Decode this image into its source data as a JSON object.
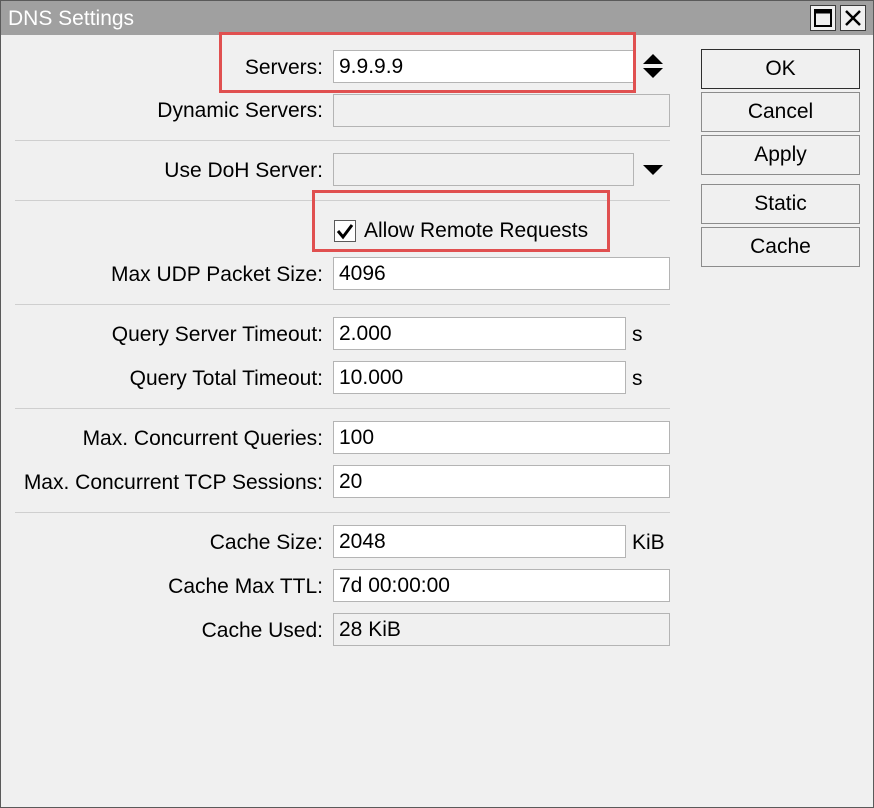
{
  "window": {
    "title": "DNS Settings",
    "maximize_icon": "maximize-icon",
    "close_icon": "close-icon"
  },
  "fields": {
    "servers": {
      "label": "Servers:",
      "value": "9.9.9.9"
    },
    "dynamic_servers": {
      "label": "Dynamic Servers:",
      "value": ""
    },
    "use_doh_server": {
      "label": "Use DoH Server:",
      "value": ""
    },
    "allow_remote_requests": {
      "label": "Allow Remote Requests",
      "checked": true
    },
    "max_udp_packet_size": {
      "label": "Max UDP Packet Size:",
      "value": "4096"
    },
    "query_server_timeout": {
      "label": "Query Server Timeout:",
      "value": "2.000",
      "unit": "s"
    },
    "query_total_timeout": {
      "label": "Query Total Timeout:",
      "value": "10.000",
      "unit": "s"
    },
    "max_concurrent_queries": {
      "label": "Max. Concurrent Queries:",
      "value": "100"
    },
    "max_concurrent_tcp_sessions": {
      "label": "Max. Concurrent TCP Sessions:",
      "value": "20"
    },
    "cache_size": {
      "label": "Cache Size:",
      "value": "2048",
      "unit": "KiB"
    },
    "cache_max_ttl": {
      "label": "Cache Max TTL:",
      "value": "7d 00:00:00"
    },
    "cache_used": {
      "label": "Cache Used:",
      "value": "28 KiB"
    }
  },
  "buttons": {
    "ok": "OK",
    "cancel": "Cancel",
    "apply": "Apply",
    "static": "Static",
    "cache": "Cache"
  },
  "colors": {
    "highlight": "#e05050",
    "titlebar": "#a0a0a0",
    "panel": "#f0f0f0"
  }
}
